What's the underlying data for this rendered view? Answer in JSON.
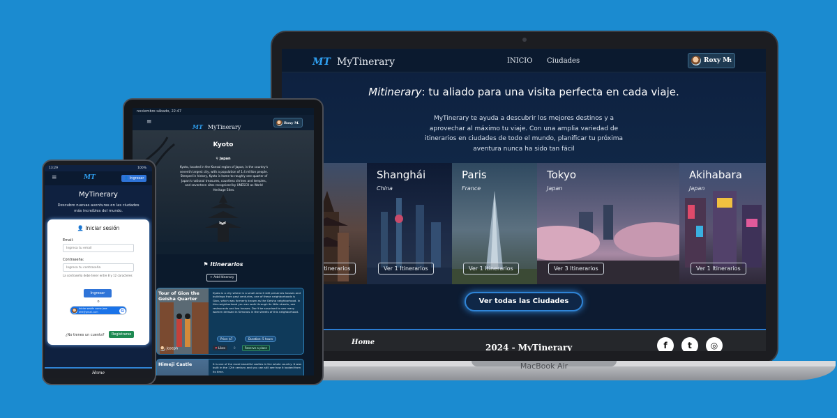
{
  "brand": {
    "logo_mark": "MT",
    "name": "MyTinerary"
  },
  "laptop": {
    "device_label": "MacBook Air",
    "nav": {
      "home": "INICIO",
      "cities": "Ciudades"
    },
    "user": {
      "name": "Roxy M."
    },
    "hero": {
      "title_em": "Mitinerary",
      "title_rest": ": tu aliado para una visita perfecta en cada viaje.",
      "text": "MyTinerary te ayuda a descubrir los mejores destinos y a aprovechar al máximo tu viaje. Con una amplia variedad de itinerarios en ciudades de todo el mundo, planificar tu próxima aventura nunca ha sido tan fácil"
    },
    "cities": [
      {
        "name": "",
        "country": "",
        "button": "Itinerarios"
      },
      {
        "name": "Shanghái",
        "country": "China",
        "button": "Ver 1 Itinerarios"
      },
      {
        "name": "Paris",
        "country": "France",
        "button": "Ver 1 Itinerarios"
      },
      {
        "name": "Tokyo",
        "country": "Japan",
        "button": "Ver 3 Itinerarios"
      },
      {
        "name": "Akihabara",
        "country": "Japan",
        "button": "Ver 1 Itinerarios"
      }
    ],
    "cta": "Ver todas las Ciudades",
    "footer": {
      "home": "Home",
      "copyright": "2024 - MyTinerary"
    },
    "social_icons": [
      "facebook-icon",
      "twitter-icon",
      "instagram-icon"
    ]
  },
  "tablet": {
    "status_time": "noviembre sábado, 22:47",
    "user": "Roxy M.",
    "city": "Kyoto",
    "country": "Japan",
    "description": "Kyoto, located in the Kansai region of Japan, is the country's seventh largest city, with a population of 1.4 million people. Steeped in history, Kyoto is home to roughly one quarter of Japan's national treasures, countless shrines and temples, and seventeen sites recognized by UNESCO as World Heritage Sites.",
    "itineraries_title": "Itinerarios",
    "add_itinerary": "+ Add Itinerary",
    "itinerary1": {
      "title": "Tour of Gion the Geisha Quarter",
      "text": "Kyoto is a city where in a small area it still preserves houses and buildings from past centuries, one of these neighborhoods is Gion, which was formerly known as the Geisha neighborhood. In this neighborhood you can walk through its little streets, see restaurants and tea houses. Don't be surprised to see many women dressed in Kimonos in the streets of this neighborhood.",
      "price": "Price: $7",
      "duration": "Duration: 5 hours",
      "author": "Joseph",
      "likes": "Likes",
      "like_count": "0",
      "reserve": "Reserve a place"
    },
    "itinerary2": {
      "title": "Himeji Castle",
      "text": "It is one of the most beautiful castles in the whole country. It was built in the 12th century and you can still see how it looked from its time."
    }
  },
  "phone": {
    "status_time": "13:29",
    "battery": "100%",
    "login_button": "Ingresar",
    "title": "MyTinerary",
    "subtitle": "Descubre nuevas aventuras en las ciudades más increíbles del mundo.",
    "card_title": "Iniciar sesión",
    "email_label": "Email:",
    "email_placeholder": "Ingresa tu email",
    "password_label": "Contraseña:",
    "password_placeholder": "Ingresa tu contraseña",
    "password_hint": "La contraseña debe tener entre 8 y 12 caracteres",
    "submit": "Ingresar",
    "or": "o",
    "google_line1": "Iniciar sesión como Jose",
    "google_line2": "dfel@gmail.com",
    "no_account": "¿No tienes un cuenta?",
    "register": "Registrarse",
    "footer_home": "Home"
  },
  "colors": {
    "background": "#1b8bd0",
    "accent": "#2f84d6",
    "dark": "#0d1b31"
  }
}
